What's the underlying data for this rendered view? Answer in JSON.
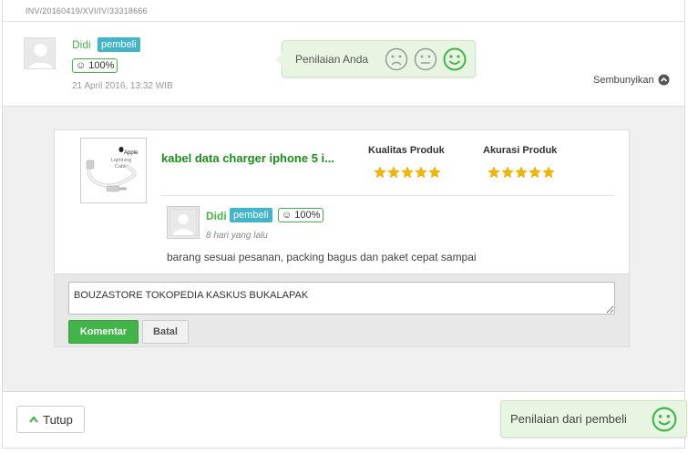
{
  "invoice": "INV/20160419/XVI/IV/33318666",
  "seller": {
    "name": "Didi",
    "role": "pembeli",
    "reputation": "100%",
    "date": "21 April 2016, 13:32 WIB"
  },
  "rating_popup": {
    "label": "Penilaian Anda",
    "faces": [
      "sad-face-icon",
      "neutral-face-icon",
      "smile-face-icon"
    ],
    "selected": "smile-face-icon"
  },
  "hide_link": "Sembunyikan",
  "product": {
    "name": "kabel data charger iphone 5 i...",
    "image_text": [
      "Apple",
      "Lightning",
      "Cable"
    ],
    "quality_title": "Kualitas Produk",
    "quality_stars": 5,
    "accuracy_title": "Akurasi Produk",
    "accuracy_stars": 5
  },
  "review": {
    "name": "Didi",
    "role": "pembeli",
    "reputation": "100%",
    "time": "8 hari yang lalu",
    "text": "barang sesuai pesanan, packing bagus dan paket cepat sampai"
  },
  "comment": {
    "value": "BOUZASTORE TOKOPEDIA KASKUS BUKALAPAK",
    "submit_label": "Komentar",
    "cancel_label": "Batal"
  },
  "footer": {
    "close_label": "Tutup",
    "buyer_rating_label": "Penilaian dari pembeli"
  },
  "colors": {
    "green": "#42b549",
    "badge": "#42b5c9",
    "star": "#f7b500",
    "popup_bg": "#e8f5e2"
  }
}
